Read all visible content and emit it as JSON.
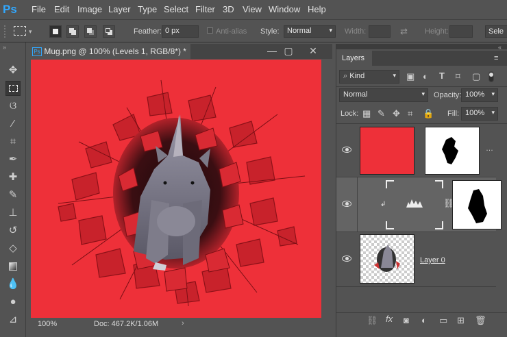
{
  "app": {
    "logo": "Ps"
  },
  "menu": [
    "File",
    "Edit",
    "Image",
    "Layer",
    "Type",
    "Select",
    "Filter",
    "3D",
    "View",
    "Window",
    "Help"
  ],
  "options": {
    "feather_label": "Feather:",
    "feather_value": "0 px",
    "antialias_label": "Anti-alias",
    "style_label": "Style:",
    "style_value": "Normal",
    "width_label": "Width:",
    "height_label": "Height:",
    "select_btn": "Sele"
  },
  "document": {
    "tab_title": "Mug.png @ 100% (Levels 1, RGB/8*) *",
    "zoom": "100%",
    "doc_size": "Doc: 467.2K/1.06M",
    "canvas_color": "#ee3039"
  },
  "layers_panel": {
    "title": "Layers",
    "filter_kind": "Kind",
    "blend_mode": "Normal",
    "opacity_label": "Opacity:",
    "opacity_value": "100%",
    "lock_label": "Lock:",
    "fill_label": "Fill:",
    "fill_value": "100%",
    "layers": [
      {
        "name": "",
        "type": "color-fill",
        "color": "#ee3039"
      },
      {
        "name": "",
        "type": "adjustment-levels"
      },
      {
        "name": "Layer 0",
        "type": "pixel"
      }
    ]
  },
  "icons": [
    "move-icon",
    "marquee-icon",
    "lasso-icon",
    "magic-wand-icon",
    "crop-icon",
    "eyedropper-icon",
    "healing-icon",
    "brush-icon",
    "stamp-icon",
    "history-brush-icon",
    "eraser-icon",
    "gradient-icon",
    "blur-icon",
    "dodge-icon",
    "pen-icon"
  ]
}
